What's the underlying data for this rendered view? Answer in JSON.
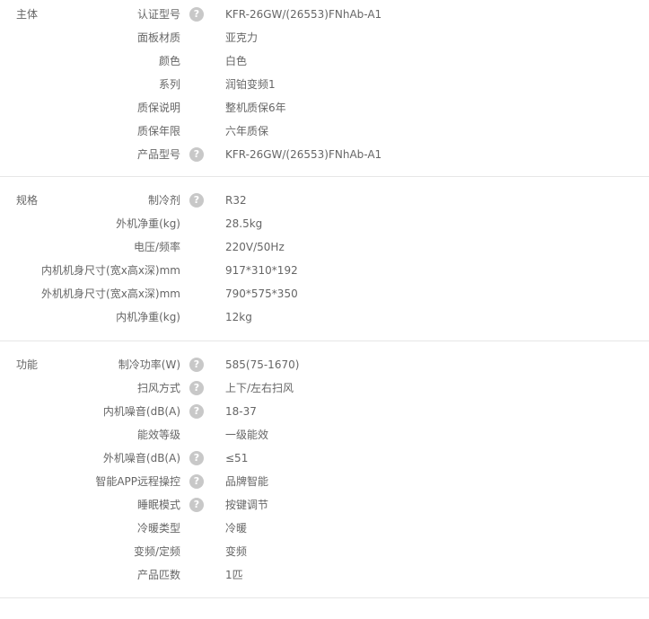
{
  "sections": [
    {
      "title": "主体",
      "rows": [
        {
          "label": "认证型号",
          "help": true,
          "value": "KFR-26GW/(26553)FNhAb-A1"
        },
        {
          "label": "面板材质",
          "help": false,
          "value": "亚克力"
        },
        {
          "label": "颜色",
          "help": false,
          "value": "白色"
        },
        {
          "label": "系列",
          "help": false,
          "value": "润铂变频1"
        },
        {
          "label": "质保说明",
          "help": false,
          "value": "整机质保6年"
        },
        {
          "label": "质保年限",
          "help": false,
          "value": "六年质保"
        },
        {
          "label": "产品型号",
          "help": true,
          "value": "KFR-26GW/(26553)FNhAb-A1"
        }
      ]
    },
    {
      "title": "规格",
      "rows": [
        {
          "label": "制冷剂",
          "help": true,
          "value": "R32"
        },
        {
          "label": "外机净重(kg)",
          "help": false,
          "value": "28.5kg"
        },
        {
          "label": "电压/频率",
          "help": false,
          "value": "220V/50Hz"
        },
        {
          "label": "内机机身尺寸(宽x高x深)mm",
          "help": false,
          "value": "917*310*192"
        },
        {
          "label": "外机机身尺寸(宽x高x深)mm",
          "help": false,
          "value": "790*575*350"
        },
        {
          "label": "内机净重(kg)",
          "help": false,
          "value": "12kg"
        }
      ]
    },
    {
      "title": "功能",
      "rows": [
        {
          "label": "制冷功率(W)",
          "help": true,
          "value": "585(75-1670)"
        },
        {
          "label": "扫风方式",
          "help": true,
          "value": "上下/左右扫风"
        },
        {
          "label": "内机噪音(dB(A)",
          "help": true,
          "value": "18-37"
        },
        {
          "label": "能效等级",
          "help": false,
          "value": "一级能效"
        },
        {
          "label": "外机噪音(dB(A)",
          "help": true,
          "value": "≤51"
        },
        {
          "label": "智能APP远程操控",
          "help": true,
          "value": "品牌智能"
        },
        {
          "label": "睡眠模式",
          "help": true,
          "value": "按键调节"
        },
        {
          "label": "冷暖类型",
          "help": false,
          "value": "冷暖"
        },
        {
          "label": "变频/定频",
          "help": false,
          "value": "变频"
        },
        {
          "label": "产品匹数",
          "help": false,
          "value": "1匹"
        }
      ]
    }
  ],
  "help_icon_glyph": "?",
  "colors": {
    "text": "#666666",
    "help_icon": "#c8c8c8",
    "divider": "#e6e6e6"
  }
}
